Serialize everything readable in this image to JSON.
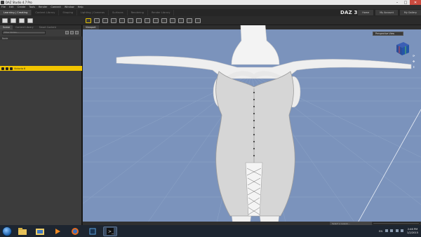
{
  "window": {
    "title": "DAZ Studio 4.7 Pro"
  },
  "menu": [
    "File",
    "Edit",
    "Create",
    "Tools",
    "Render",
    "Connect",
    "Window",
    "Help"
  ],
  "mode_tabs": [
    "Learning | Creating",
    "Content Library",
    "Shaping",
    "Lighting | Cameras",
    "Surfaces",
    "Rendering",
    "Render Library"
  ],
  "brand": "DAZ 3D",
  "top_links": [
    "Home",
    "My Account",
    "My Gallery"
  ],
  "left_panel": {
    "tabs": [
      "Scene",
      "Content Library",
      "Smart Content"
    ],
    "search_placeholder": "Filter Nodes...",
    "header": "Node",
    "selected_row": "Victoria 6"
  },
  "viewport": {
    "tab": "Viewport",
    "camera": "Perspective View",
    "background_color": "#7b93bc"
  },
  "status": {
    "lesson_placeholder": "Select a Lesson...",
    "progress": 0.0
  },
  "taskbar": {
    "language": "EN",
    "time": "2:46 PM",
    "date": "1/2/2015"
  },
  "colors": {
    "accent_selected": "#f2c500",
    "panel_bg": "#3c3c3c",
    "viewport_bg": "#7b93bc"
  }
}
